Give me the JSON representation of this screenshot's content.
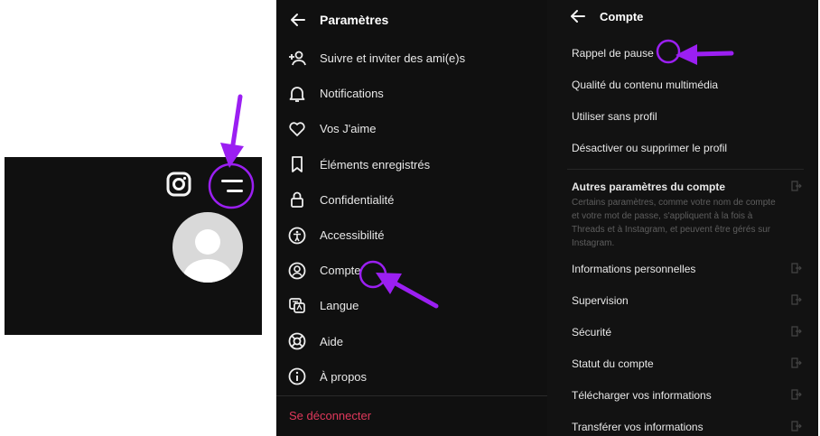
{
  "colors": {
    "background": "#101010",
    "logout": "#e0385b",
    "annotation": "#9b1ff2",
    "muted": "#5e5e5e"
  },
  "settings": {
    "title": "Paramètres",
    "items": [
      {
        "label": "Suivre et inviter des ami(e)s",
        "icon": "add-person-icon"
      },
      {
        "label": "Notifications",
        "icon": "bell-icon"
      },
      {
        "label": "Vos J'aime",
        "icon": "heart-icon"
      },
      {
        "label": "Éléments enregistrés",
        "icon": "bookmark-icon"
      },
      {
        "label": "Confidentialité",
        "icon": "lock-icon"
      },
      {
        "label": "Accessibilité",
        "icon": "accessibility-icon"
      },
      {
        "label": "Compte",
        "icon": "account-icon"
      },
      {
        "label": "Langue",
        "icon": "language-icon"
      },
      {
        "label": "Aide",
        "icon": "lifebuoy-icon"
      },
      {
        "label": "À propos",
        "icon": "info-icon"
      }
    ],
    "logout": "Se déconnecter"
  },
  "account": {
    "title": "Compte",
    "items_top": [
      {
        "label": "Rappel de pause"
      },
      {
        "label": "Qualité du contenu multimédia"
      },
      {
        "label": "Utiliser sans profil"
      },
      {
        "label": "Désactiver ou supprimer le profil"
      }
    ],
    "other": {
      "title": "Autres paramètres du compte",
      "description": "Certains paramètres, comme votre nom de compte et votre mot de passe, s'appliquent à la fois à Threads et à Instagram, et peuvent être gérés sur Instagram."
    },
    "items_bottom": [
      {
        "label": "Informations personnelles"
      },
      {
        "label": "Supervision"
      },
      {
        "label": "Sécurité"
      },
      {
        "label": "Statut du compte"
      },
      {
        "label": "Télécharger vos informations"
      },
      {
        "label": "Transférer vos informations"
      }
    ]
  }
}
